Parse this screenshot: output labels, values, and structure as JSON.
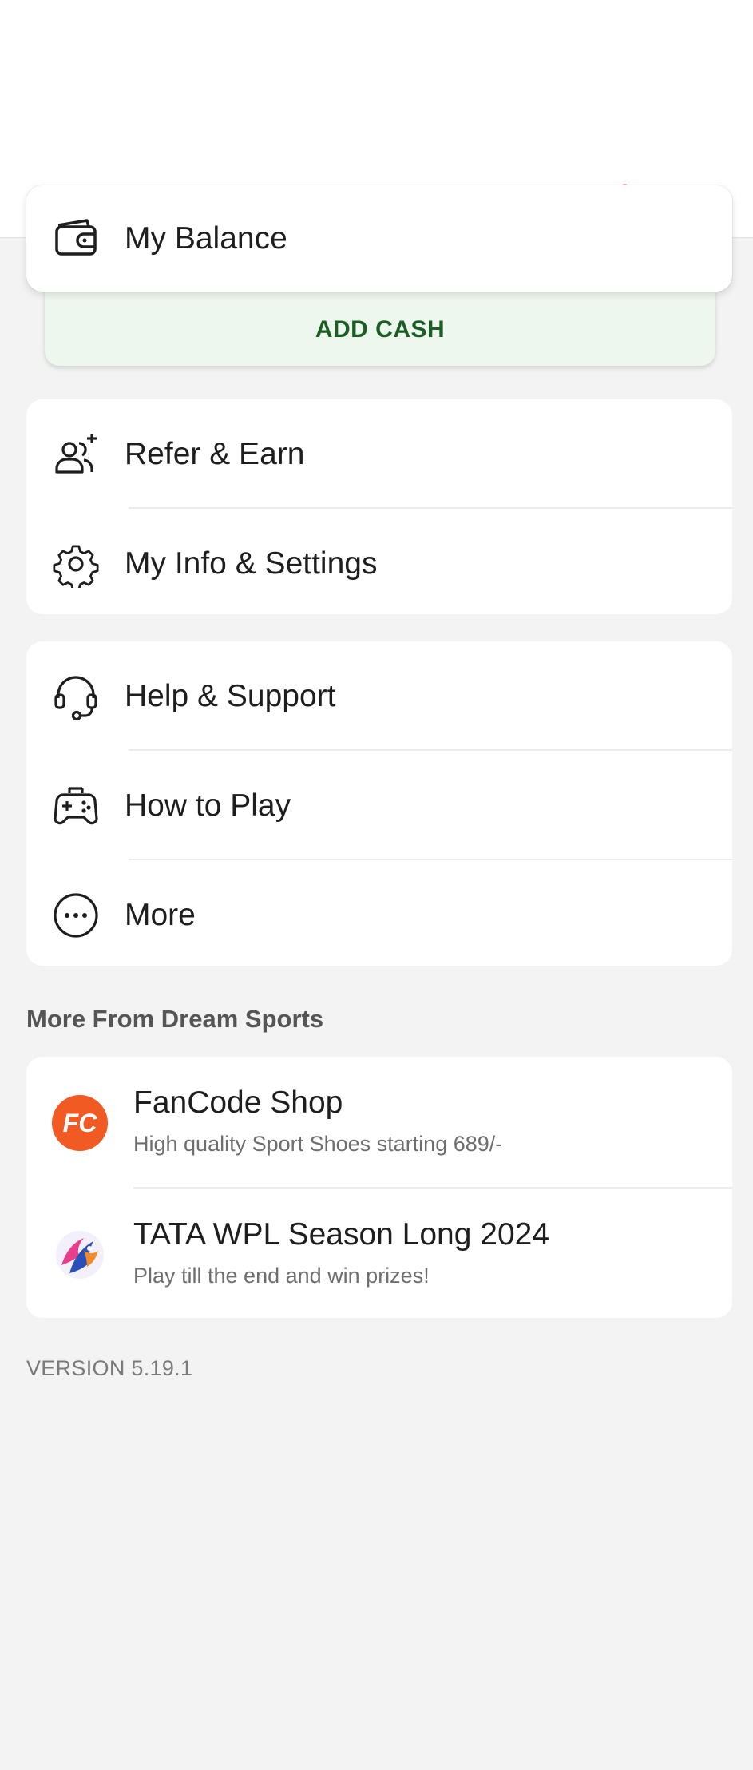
{
  "balance": {
    "label": "My Balance",
    "icon": "wallet-icon"
  },
  "add_cash": {
    "label": "ADD CASH"
  },
  "menu_group_1": [
    {
      "label": "Refer & Earn",
      "icon": "refer-users-icon"
    },
    {
      "label": "My Info & Settings",
      "icon": "gear-icon"
    }
  ],
  "menu_group_2": [
    {
      "label": "Help & Support",
      "icon": "headset-icon"
    },
    {
      "label": "How to Play",
      "icon": "gamepad-icon"
    },
    {
      "label": "More",
      "icon": "more-dots-icon"
    }
  ],
  "more_from": {
    "title": "More From Dream Sports",
    "apps": [
      {
        "title": "FanCode Shop",
        "subtitle": "High quality Sport Shoes starting 689/-",
        "icon": "fancode-logo"
      },
      {
        "title": "TATA WPL Season Long 2024",
        "subtitle": "Play till the end and win prizes!",
        "icon": "wpl-logo"
      }
    ]
  },
  "version": "VERSION 5.19.1",
  "colors": {
    "background": "#f3f3f3",
    "card": "#ffffff",
    "add_cash_bg": "#eef7ee",
    "add_cash_text": "#1a5e24",
    "fancode_orange": "#f15a22"
  }
}
